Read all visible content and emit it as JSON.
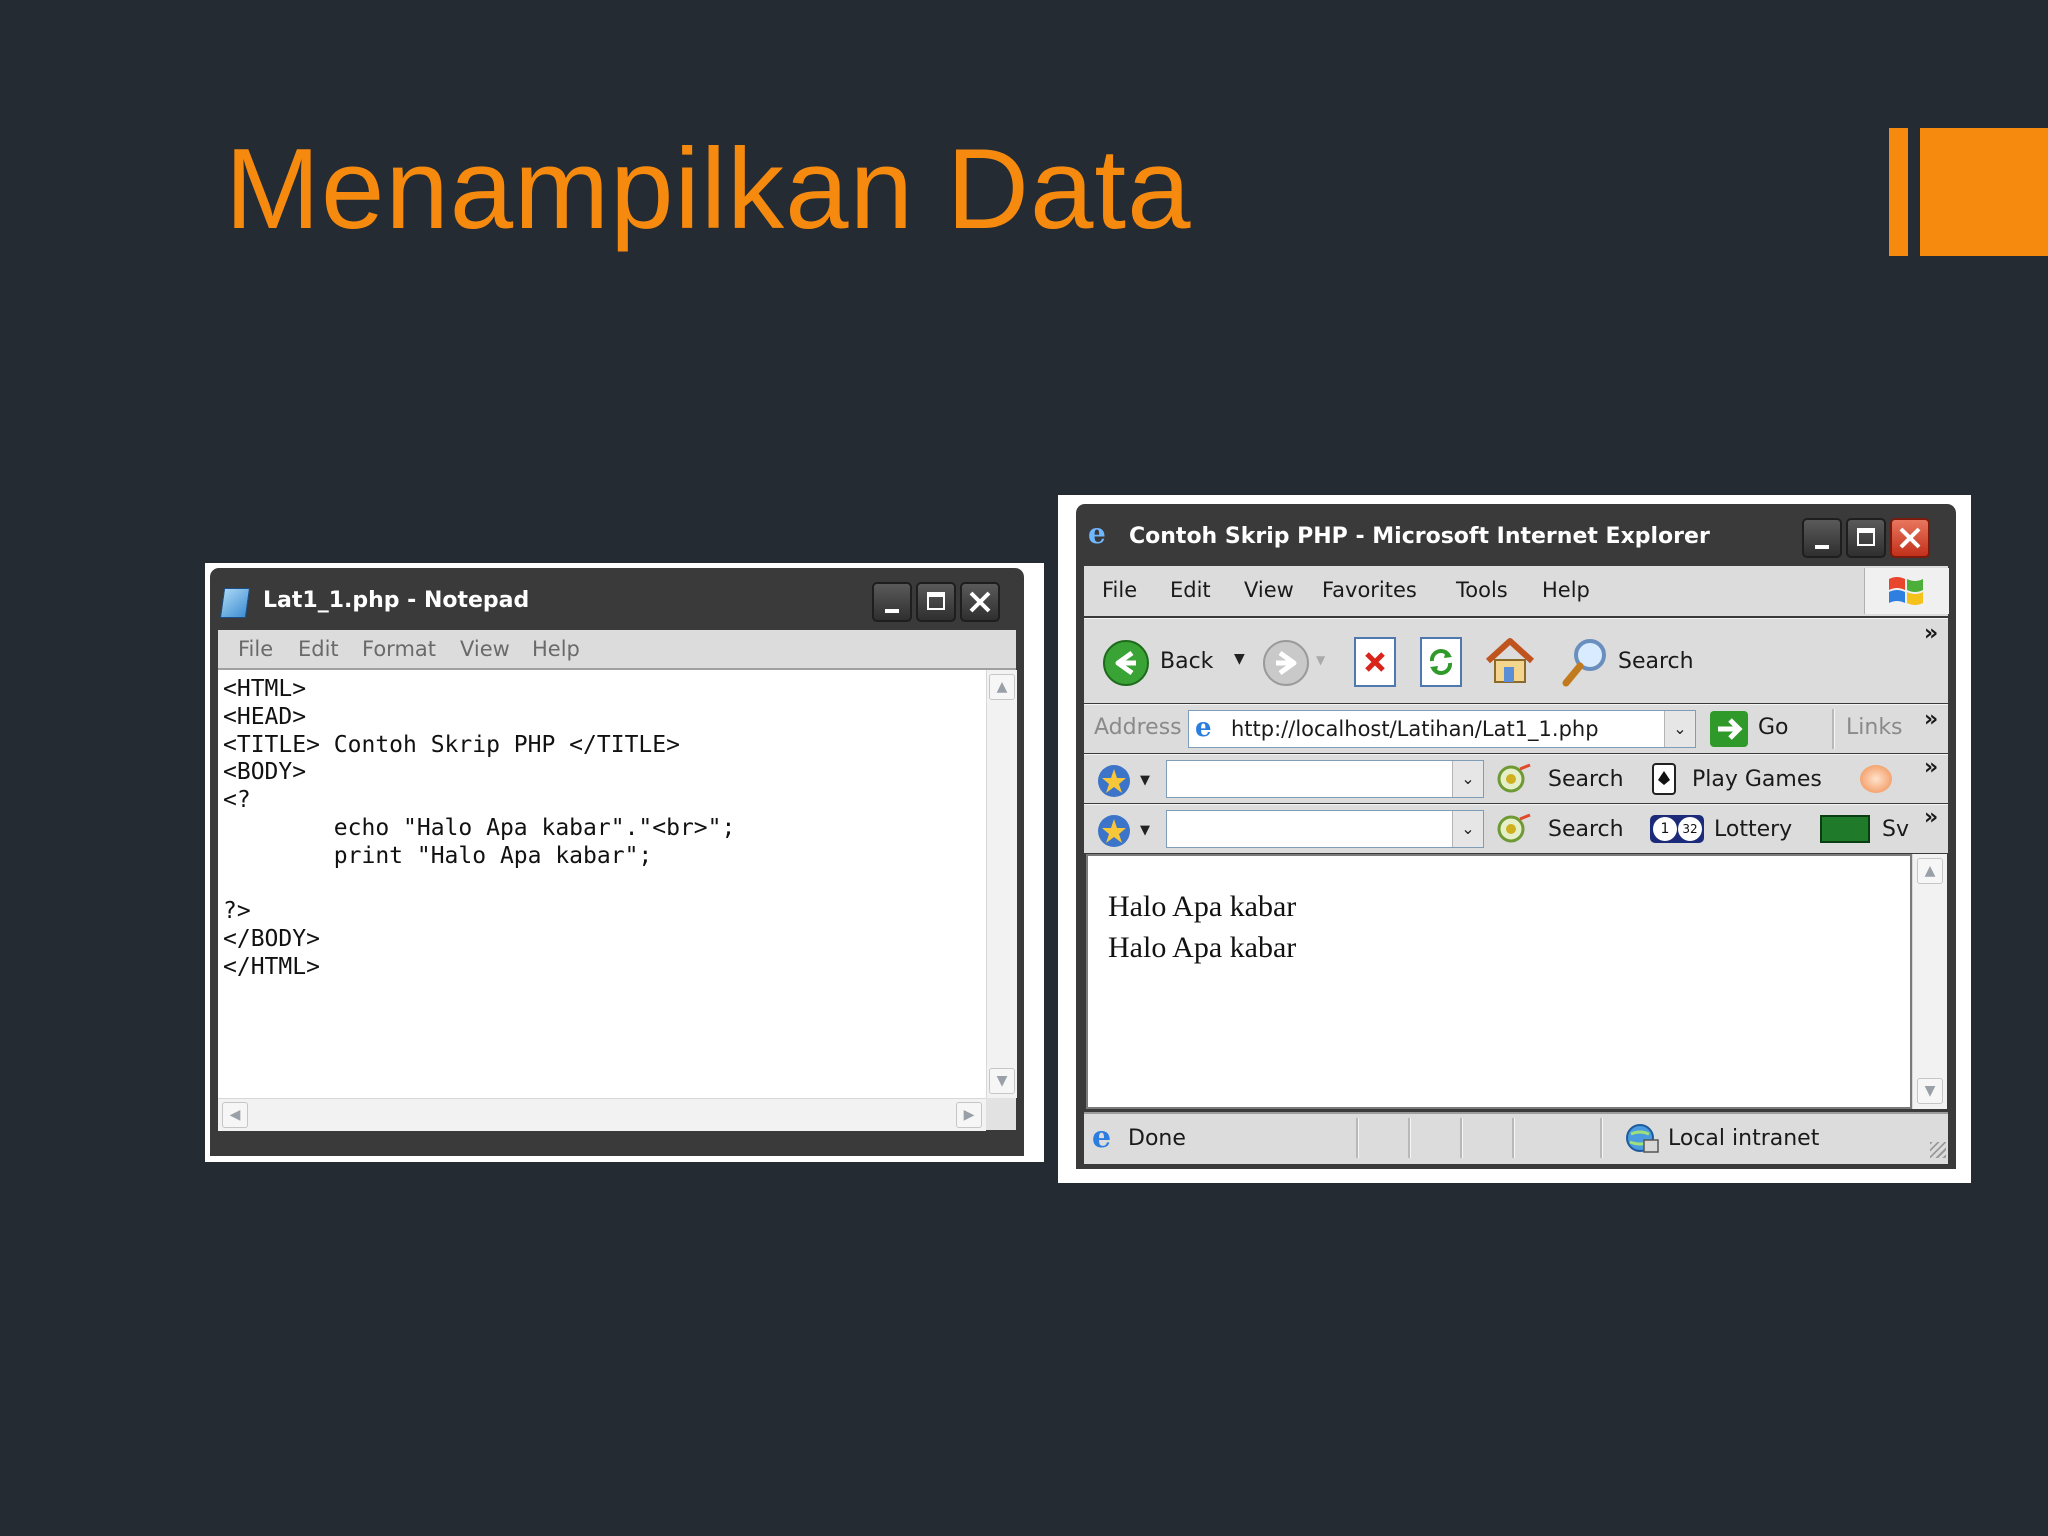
{
  "slide": {
    "title": "Menampilkan Data",
    "accent_color": "#f68a0f",
    "background_color": "#252b33"
  },
  "notepad": {
    "title": "Lat1_1.php - Notepad",
    "menu": [
      "File",
      "Edit",
      "Format",
      "View",
      "Help"
    ],
    "code_lines": [
      "<HTML>",
      "<HEAD>",
      "<TITLE> Contoh Skrip PHP </TITLE>",
      "<BODY>",
      "<?",
      "        echo \"Halo Apa kabar\".\"<br>\";",
      "        print \"Halo Apa kabar\";",
      "",
      "?>",
      "</BODY>",
      "</HTML>"
    ]
  },
  "browser": {
    "title": "Contoh Skrip PHP - Microsoft Internet Explorer",
    "menu": [
      "File",
      "Edit",
      "View",
      "Favorites",
      "Tools",
      "Help"
    ],
    "toolbar": {
      "back_label": "Back",
      "search_label": "Search"
    },
    "address": {
      "label": "Address",
      "url": "http://localhost/Latihan/Lat1_1.php",
      "go_label": "Go",
      "links_label": "Links"
    },
    "links_bar_1": {
      "search_label": "Search",
      "play_games_label": "Play Games"
    },
    "links_bar_2": {
      "search_label": "Search",
      "lottery_label": "Lottery",
      "lottery_badge_1": "1",
      "lottery_badge_2": "32",
      "truncated_label": "Sv"
    },
    "page_lines": [
      "Halo Apa kabar",
      "Halo Apa kabar"
    ],
    "status": {
      "text": "Done",
      "zone": "Local intranet"
    }
  }
}
